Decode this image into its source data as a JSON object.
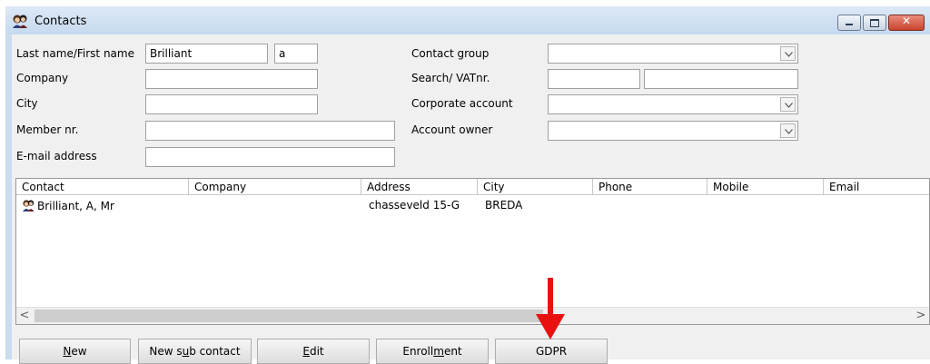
{
  "window": {
    "title": "Contacts"
  },
  "search_form": {
    "last_first_label": "Last name/First name",
    "last_name_value": "Brilliant",
    "first_name_value": "a",
    "company_label": "Company",
    "company_value": "",
    "city_label": "City",
    "city_value": "",
    "member_label": "Member nr.",
    "member_value": "",
    "email_label": "E-mail address",
    "email_value": "",
    "contact_group_label": "Contact group",
    "contact_group_value": "",
    "search_vat_label": "Search/ VATnr.",
    "search_value": "",
    "vat_value": "",
    "corporate_label": "Corporate account",
    "corporate_value": "",
    "owner_label": "Account owner",
    "owner_value": ""
  },
  "results": {
    "columns": [
      "Contact",
      "Company",
      "Address",
      "City",
      "Phone",
      "Mobile",
      "Email"
    ],
    "rows": [
      {
        "contact": "Brilliant, A, Mr",
        "company": "",
        "address": "chasseveld 15-G",
        "city": "BREDA",
        "phone": "",
        "mobile": "",
        "email": ""
      }
    ]
  },
  "buttons": {
    "new_pre": "",
    "new_key": "N",
    "new_post": "ew",
    "subcontact_pre": "New s",
    "subcontact_key": "u",
    "subcontact_post": "b contact",
    "edit_pre": "",
    "edit_key": "E",
    "edit_post": "dit",
    "enrollment_pre": "Enroll",
    "enrollment_key": "m",
    "enrollment_post": "ent",
    "gdpr_label": "GDPR"
  },
  "colors": {
    "annotation_arrow": "#e8110f",
    "close_button": "#c8432e"
  }
}
